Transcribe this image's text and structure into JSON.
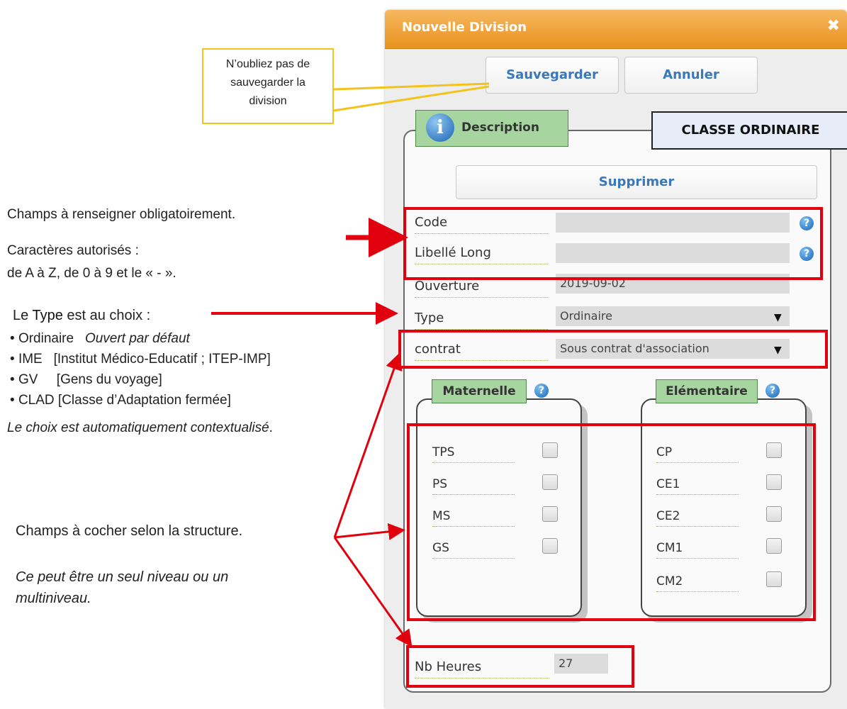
{
  "dialog": {
    "title": "Nouvelle Division",
    "close_glyph": "✖",
    "save_label": "Sauvegarder",
    "cancel_label": "Annuler"
  },
  "description": {
    "legend": "Description",
    "info_glyph": "i",
    "classe": "CLASSE ORDINAIRE",
    "delete_label": "Supprimer"
  },
  "fields": {
    "code_label": "Code",
    "code_value": "",
    "libelle_label": "Libellé Long",
    "libelle_value": "",
    "ouverture_label": "Ouverture",
    "ouverture_value": "2019-09-02",
    "type_label": "Type",
    "type_value": "Ordinaire",
    "contrat_label": "contrat",
    "contrat_value": "Sous contrat d'association",
    "help_glyph": "?",
    "caret_glyph": "▼"
  },
  "maternelle": {
    "legend": "Maternelle",
    "levels": [
      "TPS",
      "PS",
      "MS",
      "GS"
    ]
  },
  "elementaire": {
    "legend": "Elémentaire",
    "levels": [
      "CP",
      "CE1",
      "CE2",
      "CM1",
      "CM2"
    ]
  },
  "nb_heures": {
    "label": "Nb Heures",
    "value": "27"
  },
  "annotations": {
    "callout": [
      "N’oubliez pas de",
      "sauvegarder la",
      "division"
    ],
    "required": "Champs à renseigner obligatoirement.",
    "allowed_title": "Caractères autorisés :",
    "allowed_range": "de A à Z, de 0 à 9 et le « - ».",
    "type_prefix": "Le ",
    "type_word": "Type",
    "type_suffix": " est au choix :",
    "options": [
      {
        "name": "Ordinaire",
        "desc": "Ouvert par défaut"
      },
      {
        "name": "IME",
        "desc": "[Institut Médico-Educatif ; ITEP-IMP]"
      },
      {
        "name": "GV",
        "desc": "[Gens du voyage]"
      },
      {
        "name": "CLAD",
        "desc": "[Classe d’Adaptation fermée]"
      }
    ],
    "contextual": "Le choix est automatiquement contextualisé",
    "contextual_end": ".",
    "checkbox_note": "Champs à cocher selon la structure.",
    "level_note_1": "Ce peut être un seul niveau ou un",
    "level_note_2": "multiniveau."
  },
  "colors": {
    "titlebar": "#e8921f",
    "legend_green": "#a6d5a0",
    "link_blue": "#3a78b9",
    "annotation_red": "#e0000e",
    "callout_yellow": "#f2c31a"
  }
}
